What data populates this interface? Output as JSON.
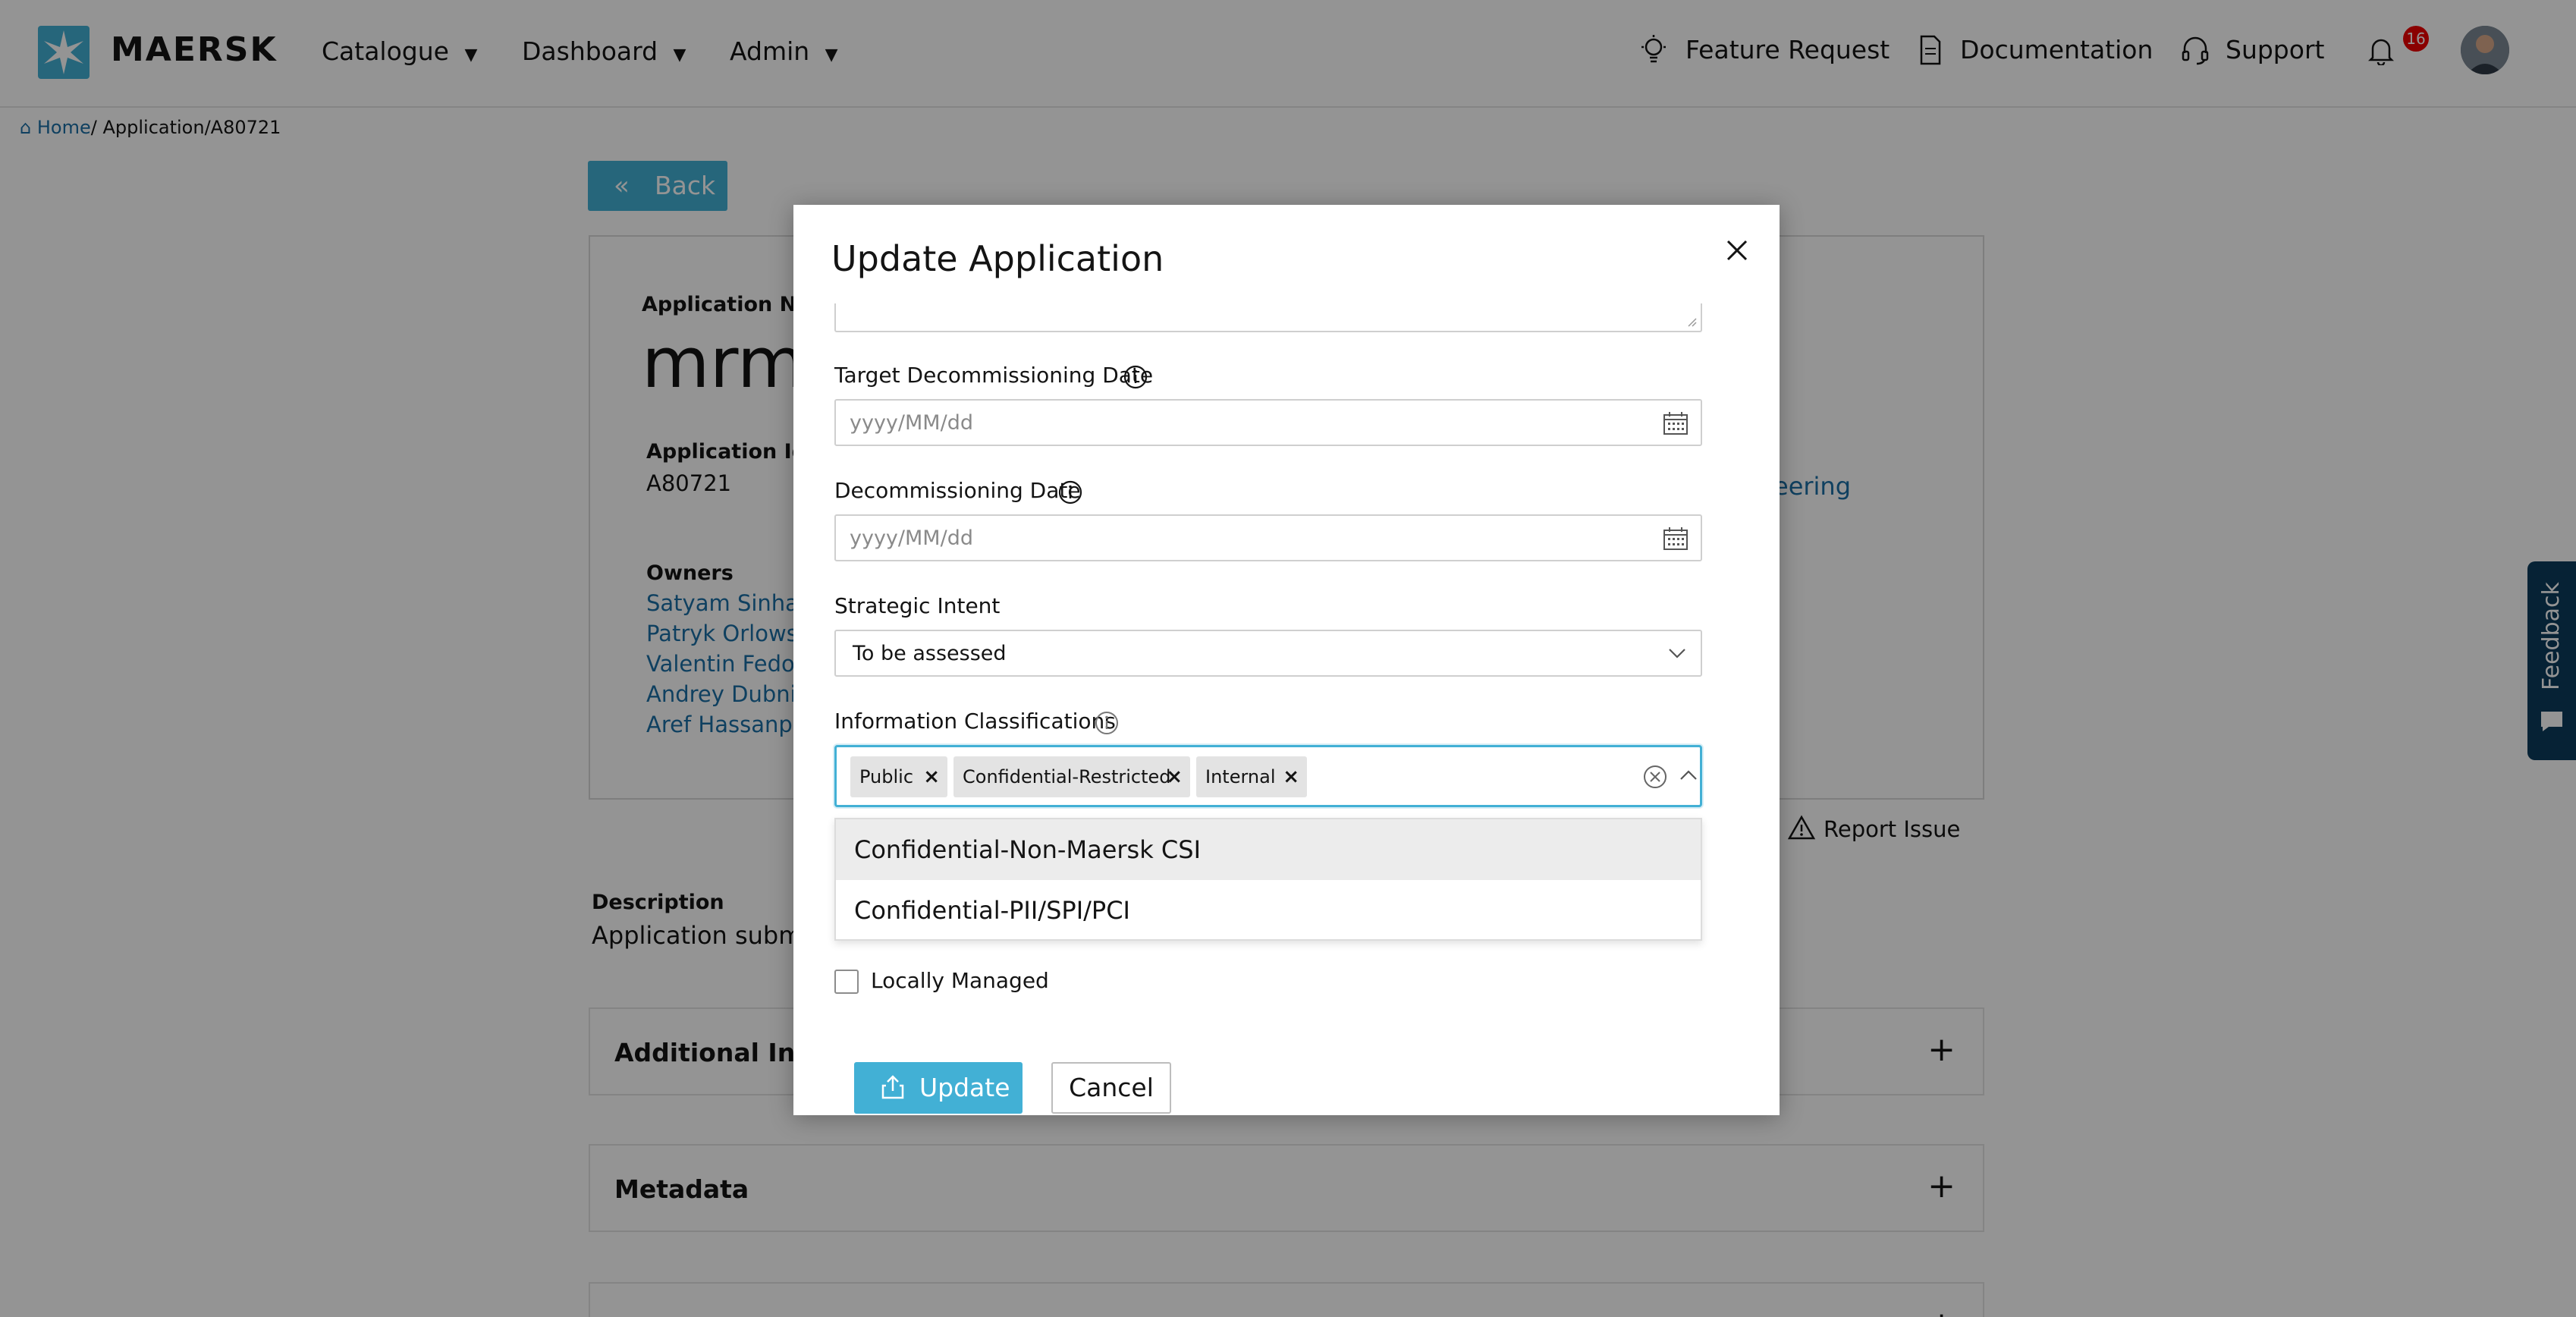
{
  "brand": {
    "name": "MAERSK",
    "accent": "#42b0d5"
  },
  "nav": {
    "catalogue": "Catalogue",
    "dashboard": "Dashboard",
    "admin": "Admin",
    "caret": "▼",
    "feature_request": "Feature Request",
    "documentation": "Documentation",
    "support": "Support",
    "notifications_count": "16"
  },
  "breadcrumb": {
    "home": "Home",
    "rest": "/ Application/A80721"
  },
  "page": {
    "back_label": "Back",
    "app_name_label": "Application Nar",
    "app_name_value": "mrmp",
    "app_id_label": "Application Id",
    "app_id_value": "A80721",
    "right_link_fragment": "eering",
    "owners_label": "Owners",
    "owners": [
      "Satyam Sinha",
      "Patryk Orlowski",
      "Valentin Fedosk",
      "Andrey Dubnik",
      "Aref Hassanpoc"
    ],
    "report_issue": "Report Issue",
    "description_label": "Description",
    "description_value": "Application submit",
    "additional_info": "Additional Infor",
    "metadata": "Metadata",
    "feedback": "Feedback"
  },
  "modal": {
    "title": "Update Application",
    "target_decom_label": "Target Decommissioning Date",
    "target_decom_placeholder": "yyyy/MM/dd",
    "decom_label": "Decommissioning Date",
    "decom_placeholder": "yyyy/MM/dd",
    "strategic_intent_label": "Strategic Intent",
    "strategic_intent_value": "To be assessed",
    "info_class_label": "Information Classifications",
    "selected_tags": [
      "Public",
      "Confidential-Restricted",
      "Internal"
    ],
    "tag_remove": "×",
    "dropdown_options": [
      "Confidential-Non-Maersk CSI",
      "Confidential-PII/SPI/PCI"
    ],
    "locally_managed_label": "Locally Managed",
    "update_label": "Update",
    "cancel_label": "Cancel"
  }
}
